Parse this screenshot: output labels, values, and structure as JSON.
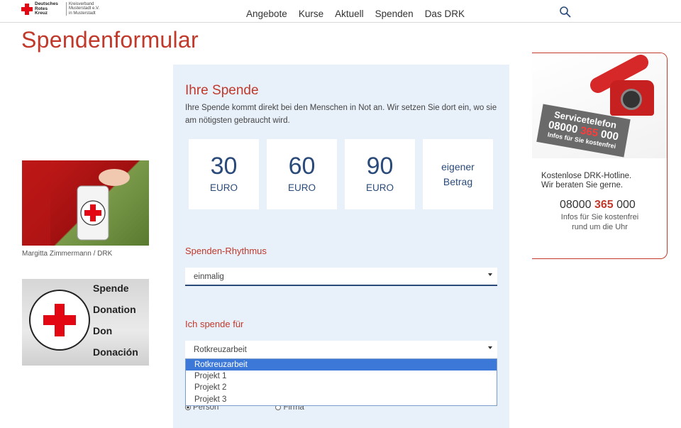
{
  "header": {
    "logo": {
      "name_lines": [
        "Deutsches",
        "Rotes",
        "Kreuz"
      ],
      "org_lines": [
        "Kreisverband",
        "Musterstadt e.V.",
        "in Musterstadt"
      ]
    },
    "nav": [
      "Angebote",
      "Kurse",
      "Aktuell",
      "Spenden",
      "Das DRK"
    ],
    "search_icon": "search-icon"
  },
  "page_title": "Spendenformular",
  "left": {
    "image1_caption": "Margitta Zimmermann / DRK",
    "image2_lines": [
      "Spende",
      "Donation",
      "Don",
      "Donación"
    ]
  },
  "form": {
    "title": "Ihre Spende",
    "intro": "Ihre Spende kommt direkt bei den Menschen in Not an. Wir setzen Sie dort ein, wo sie am nötigsten gebraucht wird.",
    "amounts": [
      {
        "value": "30",
        "currency": "EURO"
      },
      {
        "value": "60",
        "currency": "EURO"
      },
      {
        "value": "90",
        "currency": "EURO"
      }
    ],
    "custom_amount": {
      "line1": "eigener",
      "line2": "Betrag"
    },
    "rhythm_label": "Spenden-Rhythmus",
    "rhythm_value": "einmalig",
    "purpose_label": "Ich spende für",
    "purpose_value": "Rotkreuzarbeit",
    "purpose_options": [
      "Rotkreuzarbeit",
      "Projekt 1",
      "Projekt 2",
      "Projekt 3"
    ],
    "donor_type": {
      "person": "Person",
      "company": "Firma"
    }
  },
  "hotline": {
    "banner_title": "Servicetelefon",
    "banner_number_a": "08000 ",
    "banner_number_b": "365",
    "banner_number_c": " 000",
    "banner_sub": "Infos für Sie kostenfrei",
    "text_line1": "Kostenlose DRK-Hotline.",
    "text_line2": "Wir beraten Sie gerne.",
    "number_a": "08000 ",
    "number_b": "365",
    "number_c": " 000",
    "sub_line1": "Infos für Sie kostenfrei",
    "sub_line2": "rund um die Uhr"
  },
  "colors": {
    "accent_red": "#c0392b",
    "brand_red": "#e30613",
    "navy": "#2a4a7a",
    "panel_bg": "#e8f0fa",
    "option_selected": "#3b78d8"
  }
}
